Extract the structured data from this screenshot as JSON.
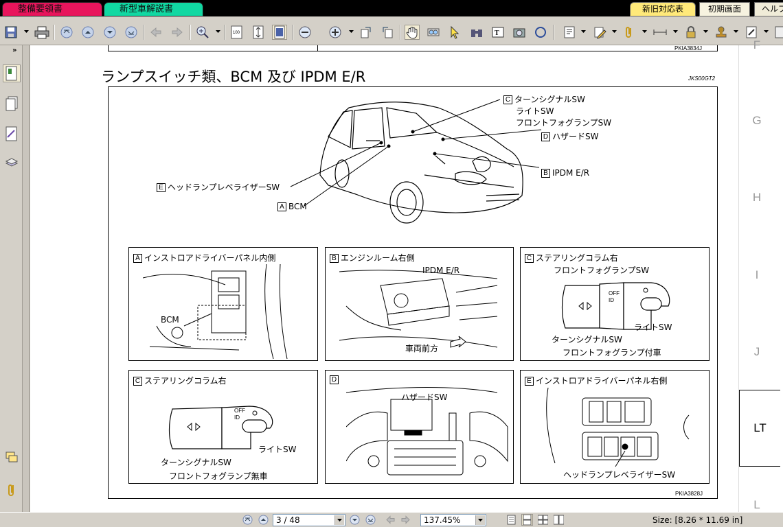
{
  "tabs": {
    "left": [
      "整備要領書",
      "新型車解説書"
    ],
    "right": [
      "新旧対応表",
      "初期画面",
      "ヘルプ"
    ]
  },
  "toolbar": {
    "icons": [
      "save-icon",
      "print-icon",
      "first-page-icon",
      "prev-page-icon",
      "next-page-icon",
      "last-page-icon",
      "back-icon",
      "forward-icon",
      "zoom-in-icon",
      "actual-size-icon",
      "fit-page-icon",
      "fit-width-icon",
      "zoom-out-minus-icon",
      "zoom-plus-icon",
      "rotate-icon",
      "rotate2-icon",
      "hand-icon",
      "glasses-icon",
      "select-icon",
      "binoculars-icon",
      "text-select-icon",
      "snapshot-icon",
      "circle-icon",
      "annotation-icon",
      "pencil-icon",
      "attach-icon",
      "measure-icon",
      "lock-icon",
      "stamp-icon",
      "form-icon",
      "ruler-icon"
    ]
  },
  "document": {
    "top_ref": "PKIA3834J",
    "heading": "ランプスイッチ類、BCM 及び IPDM E/R",
    "heading_ref": "JKS00GT2",
    "callouts": {
      "c_lines": [
        "ターンシグナルSW",
        "ライトSW",
        "フロントフォグランプSW"
      ],
      "d": "ハザードSW",
      "b": "IPDM E/R",
      "e": "ヘッドランプレベライザーSW",
      "a": "BCM"
    },
    "panels": [
      {
        "letter": "A",
        "title": "インストロアドライバーパネル内側",
        "labels": [
          "BCM"
        ]
      },
      {
        "letter": "B",
        "title": "エンジンルーム右側",
        "labels": [
          "IPDM E/R",
          "車両前方"
        ]
      },
      {
        "letter": "C",
        "title": "ステアリングコラム右",
        "labels": [
          "フロントフォグランプSW",
          "ライトSW",
          "ターンシグナルSW",
          "フロントフォグランプ付車"
        ]
      },
      {
        "letter": "C",
        "title": "ステアリングコラム右",
        "labels": [
          "ライトSW",
          "ターンシグナルSW",
          "フロントフォグランプ無車"
        ]
      },
      {
        "letter": "D",
        "title": "",
        "labels": [
          "ハザードSW"
        ]
      },
      {
        "letter": "E",
        "title": "インストロアドライバーパネル右側",
        "labels": [
          "ヘッドランプレベライザーSW"
        ]
      }
    ],
    "bottom_ref": "PKIA3828J",
    "switch_marks": [
      "OFF",
      "ID"
    ]
  },
  "right_index": [
    "F",
    "G",
    "H",
    "I",
    "J",
    "LT",
    "L"
  ],
  "status": {
    "page": "3 / 48",
    "zoom": "137.45%",
    "size": "Size: [8.26 * 11.69 in]"
  }
}
